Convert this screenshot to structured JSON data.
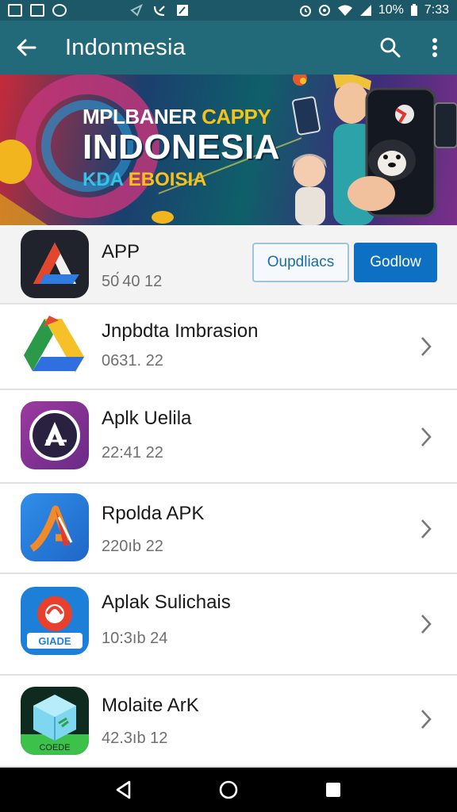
{
  "status_bar": {
    "battery": "10%",
    "time": "7:33",
    "icons": [
      "gallery-icon",
      "mail-icon",
      "app-icon",
      "send-icon",
      "missed-call-icon",
      "edit-icon",
      "alarm-icon",
      "vibrate-icon",
      "wifi-icon",
      "signal-icon",
      "battery-icon"
    ]
  },
  "app_bar": {
    "title": "Indonmesia",
    "icons": [
      "back-arrow-icon",
      "search-icon",
      "more-vert-icon"
    ],
    "color": "#226a7a"
  },
  "banner": {
    "line1_part1": "MPLBANER",
    "line1_part2": "CAPPY",
    "line2": "INDONESIA",
    "line3_part1": "KDA",
    "line3_part2": "EBOISIA"
  },
  "featured": {
    "title": "APP",
    "subtitle": "50́ 40 12",
    "button_secondary": "Oupdliacs",
    "button_primary": "Godlow"
  },
  "apps": [
    {
      "title": "Jnpbdta Imbrasion",
      "subtitle": "0631. 22",
      "icon": "drive-icon"
    },
    {
      "title": "Aplk Uelila",
      "subtitle": "22:41  22",
      "icon": "a-logo-icon"
    },
    {
      "title": "Rpolda APK",
      "subtitle": "220ıb 22",
      "icon": "red-a-icon"
    },
    {
      "title": "Aplak Sulichais",
      "subtitle": "10:3ıb 24",
      "icon": "gaade-icon"
    },
    {
      "title": "Molaite ArK",
      "subtitle": "42.3ıb 12",
      "icon": "cube-icon"
    }
  ],
  "nav_bar": {
    "icons": [
      "back-triangle-icon",
      "home-circle-icon",
      "recents-square-icon"
    ]
  },
  "colors": {
    "accent": "#0d70c2",
    "status": "#1d5868"
  }
}
